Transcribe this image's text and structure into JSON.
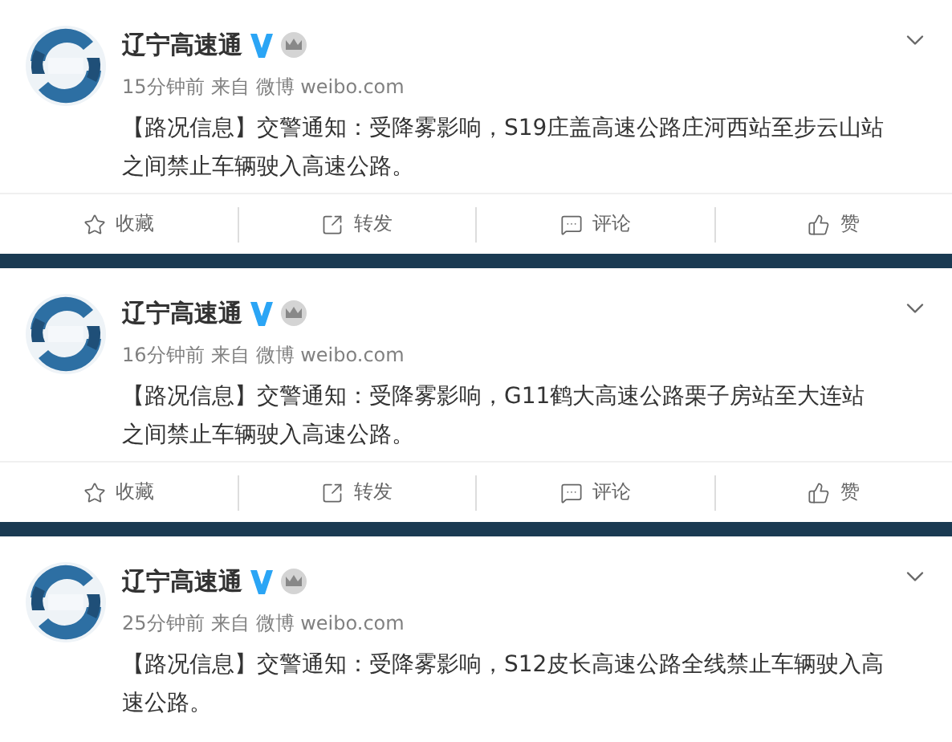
{
  "posts": [
    {
      "author": "辽宁高速通",
      "verified": true,
      "time": "15分钟前",
      "source_prefix": "来自",
      "source": "微博 weibo.com",
      "text": "【路况信息】交警通知：受降雾影响，S19庄盖高速公路庄河西站至步云山站之间禁止车辆驶入高速公路。",
      "actions": [
        {
          "kind": "favorite",
          "label": "收藏"
        },
        {
          "kind": "repost",
          "label": "转发"
        },
        {
          "kind": "comment",
          "label": "评论"
        },
        {
          "kind": "like",
          "label": "赞"
        }
      ]
    },
    {
      "author": "辽宁高速通",
      "verified": true,
      "time": "16分钟前",
      "source_prefix": "来自",
      "source": "微博 weibo.com",
      "text": "【路况信息】交警通知：受降雾影响，G11鹤大高速公路栗子房站至大连站之间禁止车辆驶入高速公路。",
      "actions": [
        {
          "kind": "favorite",
          "label": "收藏"
        },
        {
          "kind": "repost",
          "label": "转发"
        },
        {
          "kind": "comment",
          "label": "评论"
        },
        {
          "kind": "like",
          "label": "赞"
        }
      ]
    },
    {
      "author": "辽宁高速通",
      "verified": true,
      "time": "25分钟前",
      "source_prefix": "来自",
      "source": "微博 weibo.com",
      "text": "【路况信息】交警通知：受降雾影响，S12皮长高速公路全线禁止车辆驶入高速公路。"
    }
  ]
}
